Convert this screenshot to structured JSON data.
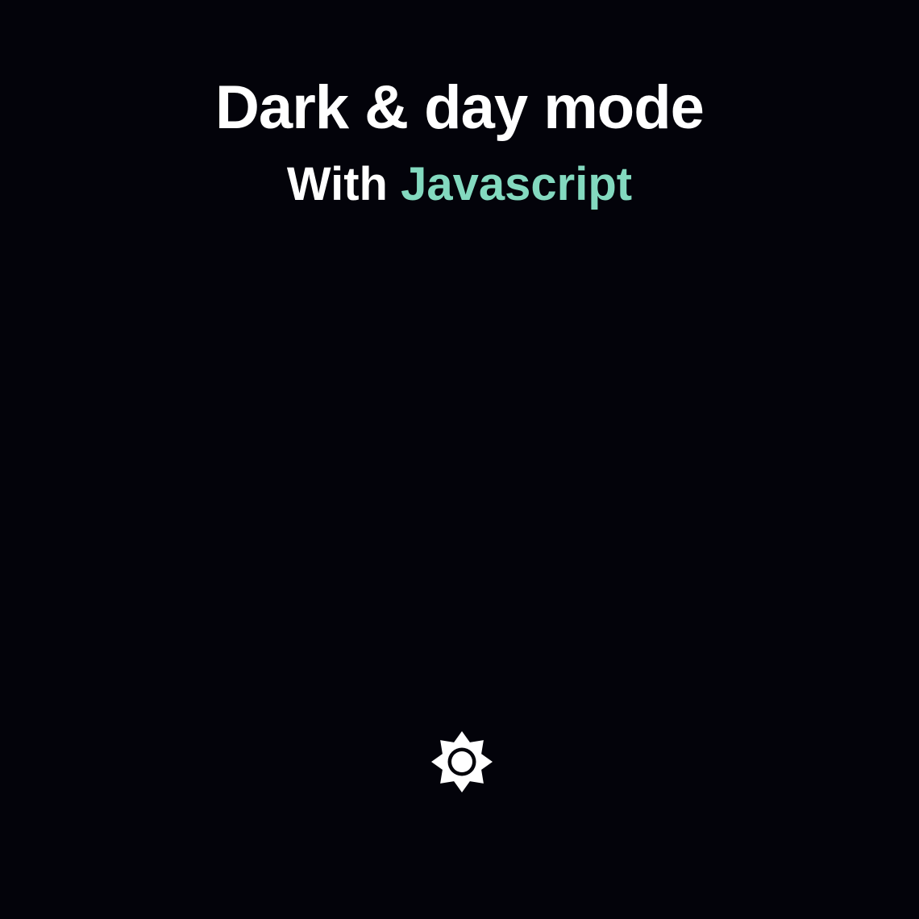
{
  "header": {
    "title": "Dark & day mode",
    "subtitle_prefix": "With",
    "subtitle_accent": "Javascript"
  },
  "theme_toggle": {
    "icon": "sun-icon",
    "current_mode": "dark"
  },
  "colors": {
    "background": "#03030a",
    "text": "#ffffff",
    "accent": "#83d9bf",
    "icon": "#ffffff"
  }
}
